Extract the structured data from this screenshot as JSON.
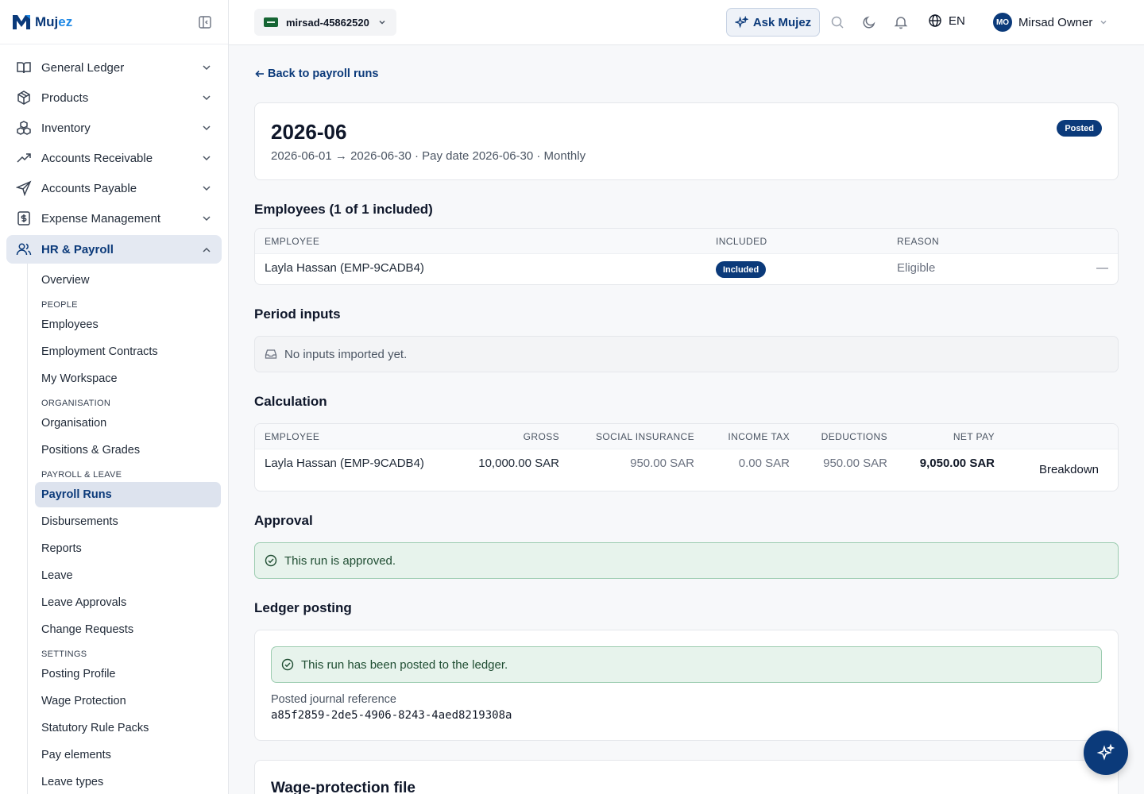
{
  "brand": {
    "name_main": "Muj",
    "name_accent": "ez"
  },
  "sidebar": {
    "items": [
      {
        "label": "General Ledger",
        "icon": "book-open-icon"
      },
      {
        "label": "Products",
        "icon": "package-icon"
      },
      {
        "label": "Inventory",
        "icon": "boxes-icon"
      },
      {
        "label": "Accounts Receivable",
        "icon": "trending-up-icon"
      },
      {
        "label": "Accounts Payable",
        "icon": "send-icon"
      },
      {
        "label": "Expense Management",
        "icon": "receipt-icon"
      },
      {
        "label": "HR & Payroll",
        "icon": "users-icon",
        "expanded": true
      }
    ],
    "hr_subnav": {
      "overview": "Overview",
      "people_heading": "PEOPLE",
      "employees": "Employees",
      "employment_contracts": "Employment Contracts",
      "my_workspace": "My Workspace",
      "organisation_heading": "ORGANISATION",
      "organisation": "Organisation",
      "positions_grades": "Positions & Grades",
      "payroll_heading": "PAYROLL & LEAVE",
      "payroll_runs": "Payroll Runs",
      "disbursements": "Disbursements",
      "reports": "Reports",
      "leave": "Leave",
      "leave_approvals": "Leave Approvals",
      "change_requests": "Change Requests",
      "settings_heading": "SETTINGS",
      "posting_profile": "Posting Profile",
      "wage_protection": "Wage Protection",
      "statutory_rule_packs": "Statutory Rule Packs",
      "pay_elements": "Pay elements",
      "leave_types": "Leave types"
    }
  },
  "topbar": {
    "org": "mirsad-45862520",
    "ask": "Ask Mujez",
    "language": "EN",
    "user_initials": "MO",
    "user_name": "Mirsad Owner"
  },
  "page": {
    "back": "Back to payroll runs",
    "title": "2026-06",
    "meta": "2026-06-01 → 2026-06-30 · Pay date 2026-06-30 · Monthly",
    "status": "Posted"
  },
  "employees": {
    "title": "Employees (1 of 1 included)",
    "columns": [
      "EMPLOYEE",
      "INCLUDED",
      "REASON"
    ],
    "rows": [
      {
        "employee": "Layla Hassan (EMP-9CADB4)",
        "included": "Included",
        "reason": "Eligible",
        "action": "—"
      }
    ]
  },
  "period_inputs": {
    "title": "Period inputs",
    "empty": "No inputs imported yet."
  },
  "calculation": {
    "title": "Calculation",
    "columns": [
      "EMPLOYEE",
      "GROSS",
      "SOCIAL INSURANCE",
      "INCOME TAX",
      "DEDUCTIONS",
      "NET PAY"
    ],
    "rows": [
      {
        "employee": "Layla Hassan (EMP-9CADB4)",
        "gross": "10,000.00 SAR",
        "social_insurance": "950.00 SAR",
        "income_tax": "0.00 SAR",
        "deductions": "950.00 SAR",
        "net_pay": "9,050.00 SAR",
        "action": "Breakdown"
      }
    ]
  },
  "approval": {
    "title": "Approval",
    "message": "This run is approved."
  },
  "ledger": {
    "title": "Ledger posting",
    "message": "This run has been posted to the ledger.",
    "ref_label": "Posted journal reference",
    "ref_value": "a85f2859-2de5-4906-8243-4aed8219308a"
  },
  "wage_protection": {
    "title": "Wage-protection file"
  },
  "colors": {
    "primary": "#0b3a7a",
    "success_bg": "#e7f3ec",
    "success_border": "#9cccb0"
  }
}
